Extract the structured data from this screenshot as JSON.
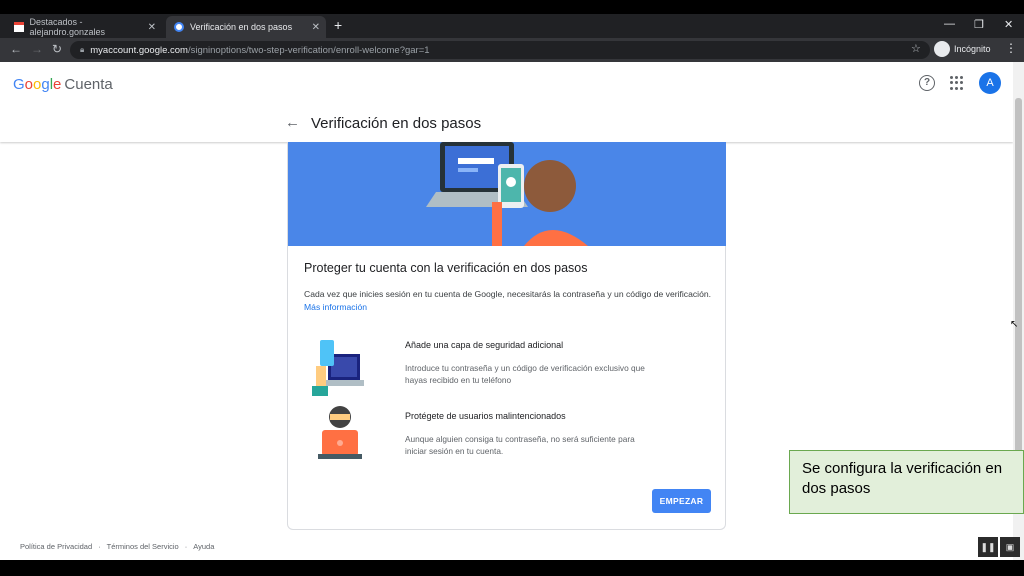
{
  "browser": {
    "tabs": [
      {
        "title": "Destacados - alejandro.gonzales",
        "close": "✕"
      },
      {
        "title": "Verificación en dos pasos",
        "close": "✕"
      }
    ],
    "new_tab": "+",
    "url_host": "myaccount.google.com",
    "url_path": "/signinoptions/two-step-verification/enroll-welcome?gar=1",
    "incognito_label": "Incógnito"
  },
  "header": {
    "logo_google": [
      "G",
      "o",
      "o",
      "g",
      "l",
      "e"
    ],
    "logo_product": "Cuenta",
    "avatar_letter": "A",
    "help_glyph": "?"
  },
  "page": {
    "title": "Verificación en dos pasos",
    "card": {
      "title": "Proteger tu cuenta con la verificación en dos pasos",
      "description": "Cada vez que inicies sesión en tu cuenta de Google, necesitarás la contraseña y un código de verificación.",
      "more_info": "Más información",
      "features": [
        {
          "title": "Añade una capa de seguridad adicional",
          "description": "Introduce tu contraseña y un código de verificación exclusivo que hayas recibido en tu teléfono"
        },
        {
          "title": "Protégete de usuarios malintencionados",
          "description": "Aunque alguien consiga tu contraseña, no será suficiente para iniciar sesión en tu cuenta."
        }
      ],
      "start_button": "EMPEZAR"
    }
  },
  "footer": {
    "links": [
      "Política de Privacidad",
      "Términos del Servicio",
      "Ayuda"
    ],
    "separator": "·"
  },
  "caption": "Se configura la verificación en dos pasos",
  "colors": {
    "accent": "#4285f4",
    "hero": "#4a86e8",
    "caption_bg": "#e2efda",
    "caption_border": "#6aa84f"
  }
}
